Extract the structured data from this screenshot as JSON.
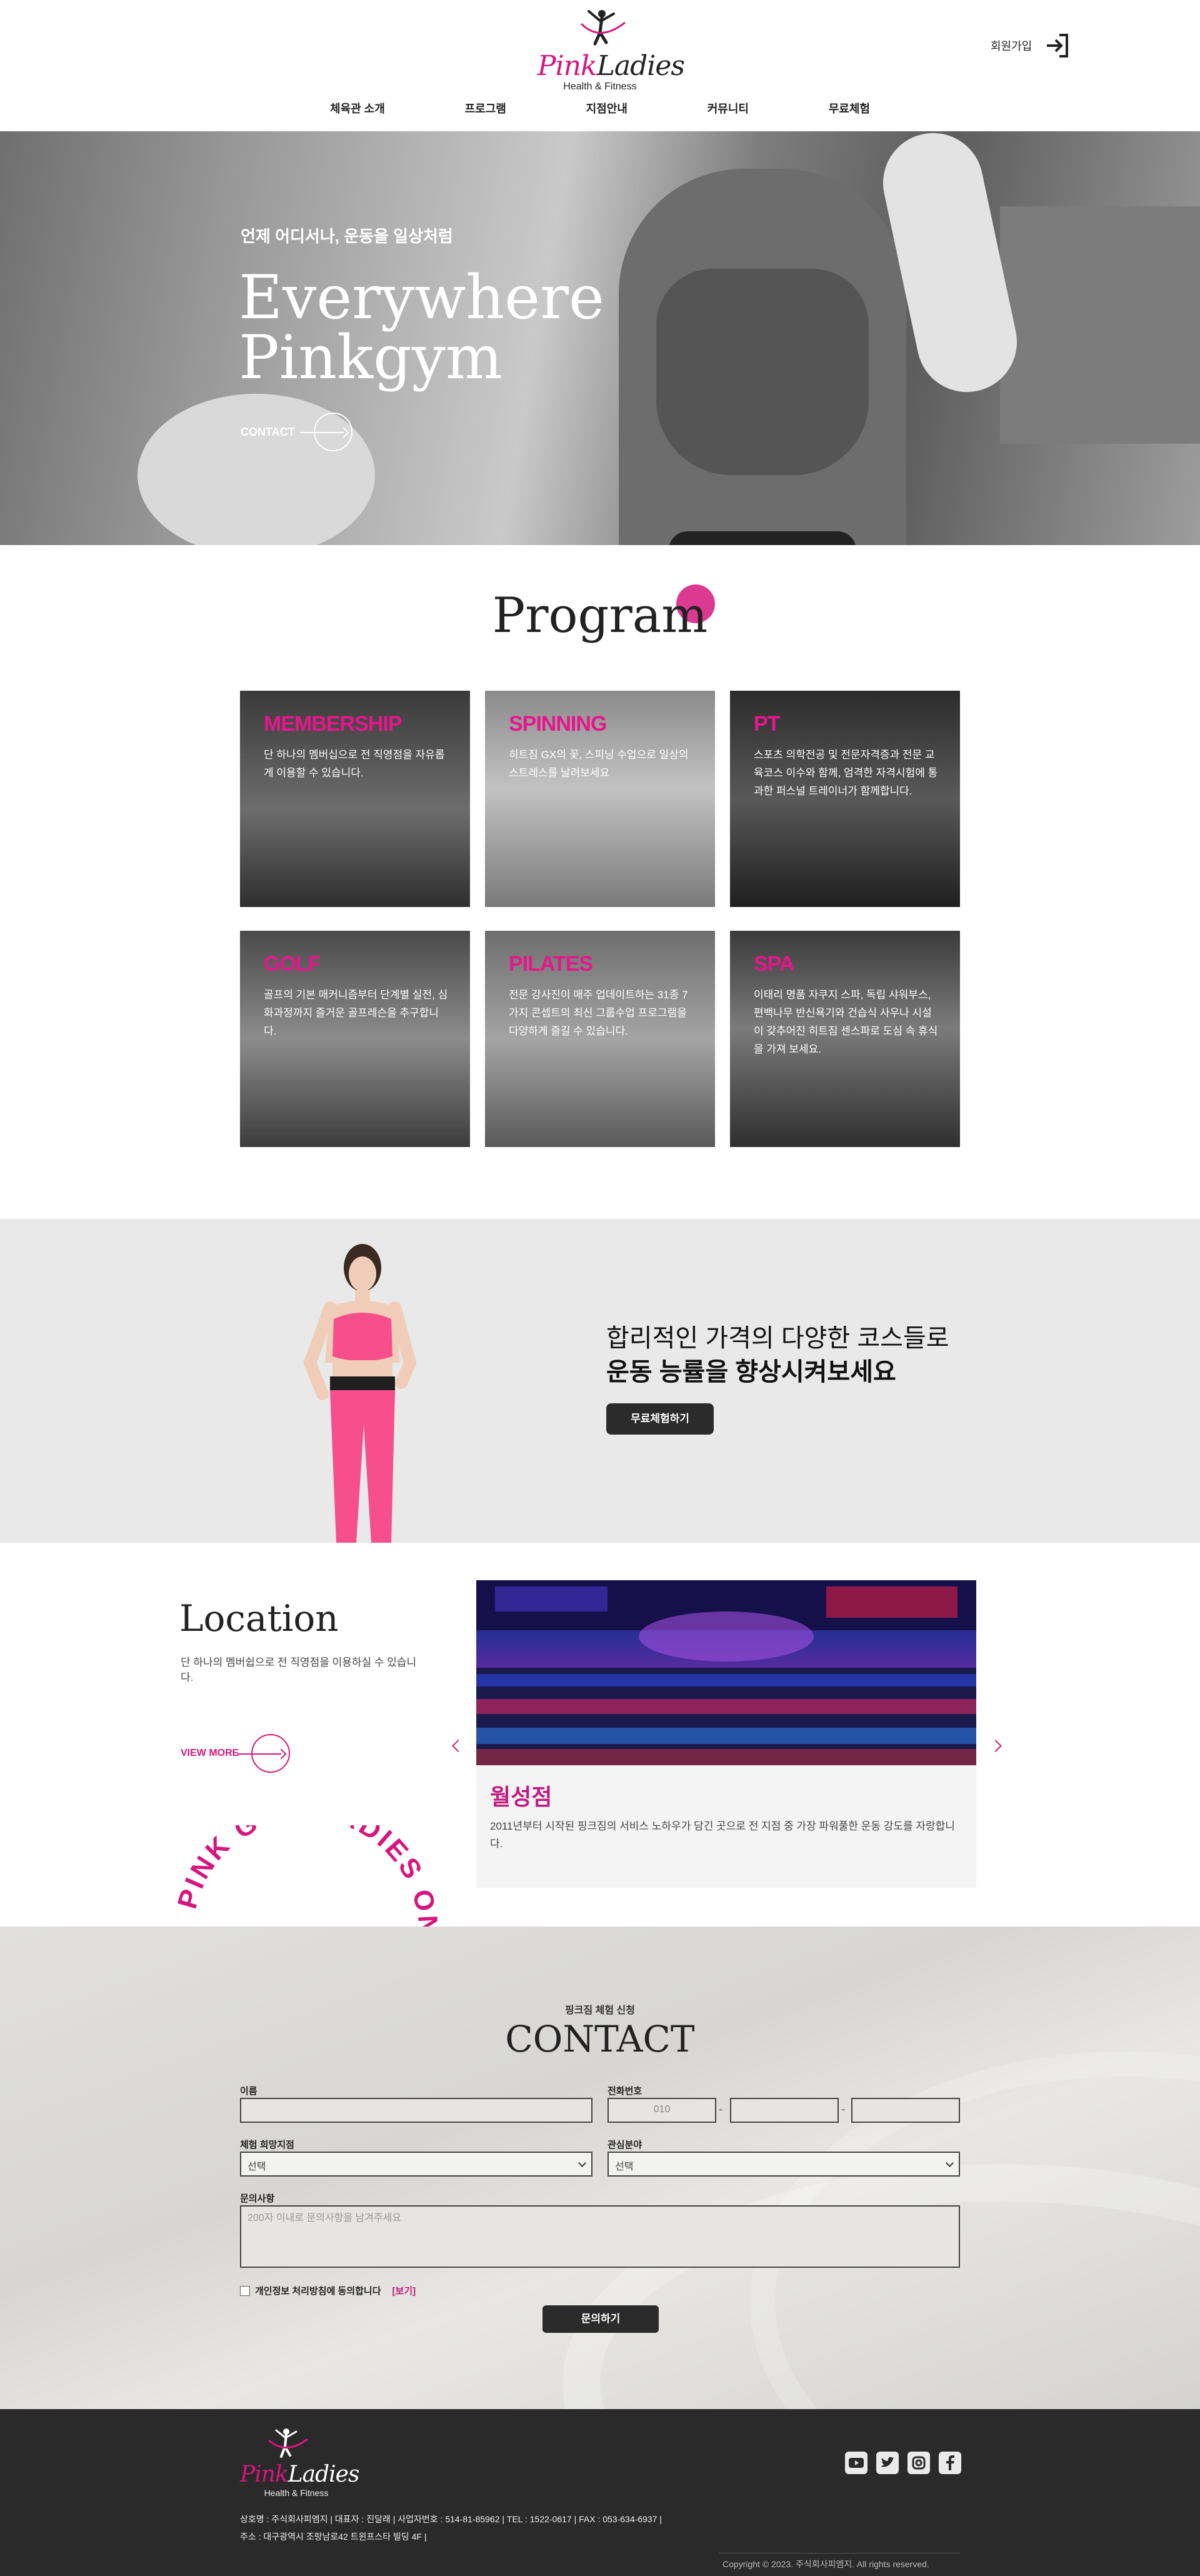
{
  "header": {
    "logo_main": "Pink",
    "logo_accent": "Ladies",
    "logo_sub": "Health & Fitness",
    "join_label": "회원가입",
    "nav": [
      "체육관 소개",
      "프로그램",
      "지점안내",
      "커뮤니티",
      "무료체험"
    ]
  },
  "hero": {
    "subtitle": "언제 어디서나, 운동을 일상처럼",
    "title_line1": "Everywhere",
    "title_line2": "Pinkgym",
    "contact_label": "CONTACT"
  },
  "program": {
    "title": "Program",
    "cards": [
      {
        "name": "MEMBERSHIP",
        "desc": "단 하나의 멤버십으로 전 직영점을 자유롭게 이용할 수 있습니다."
      },
      {
        "name": "SPINNING",
        "desc": "히트짐 GX의 꽃, 스피닝 수업으로 일상의 스트레스를 날려보세요"
      },
      {
        "name": "PT",
        "desc": "스포츠 의학전공 및 전문자격증과 전문 교육코스 이수와 함께, 엄격한 자격시험에 통과한 퍼스널 트레이너가 함께합니다."
      },
      {
        "name": "GOLF",
        "desc": "골프의 기본 매커니즘부터 단계별 실전, 심화과정까지 즐거운 골프레슨을 추구합니다."
      },
      {
        "name": "PILATES",
        "desc": "전문 강사진이 매주 업데이트하는 31종 7가지 콘셉트의 최신 그룹수업 프로그램을 다양하게 즐길 수 있습니다."
      },
      {
        "name": "SPA",
        "desc": "이태리 명품 자쿠지 스파, 독립 샤워부스, 편백나무 반신욕기와 건습식 사우나 시설이 갖추어진 히트짐 센스파로 도심 속 휴식을 가져 보세요."
      }
    ]
  },
  "banner": {
    "line1": "합리적인 가격의 다양한 코스들로",
    "line2": "운동 능률을 향상시켜보세요",
    "button": "무료체험하기"
  },
  "location": {
    "title": "Location",
    "desc": "단 하나의 멤버쉽으로 전 직영점을 이용하실 수 있습니다.",
    "view_more": "VIEW MORE",
    "rotating_text": "PINK GYM LADIES ONLY",
    "branch_name": "월성점",
    "branch_desc": "2011년부터 시작된 핑크짐의 서비스 노하우가 담긴 곳으로 전 지점 중 가장 파워풀한 운동 강도를 자랑합니다."
  },
  "contact": {
    "subtitle": "핑크짐 체험 신청",
    "title": "CONTACT",
    "name_label": "이름",
    "phone_label": "전화번호",
    "phone_placeholder": "010",
    "branch_label": "체험 희망지점",
    "branch_value": "선택",
    "interest_label": "관심분야",
    "interest_value": "선택",
    "inquiry_label": "문의사항",
    "inquiry_placeholder": "200자 이내로 문의사항을 남겨주세요",
    "agree_label": "개인정보 처리방침에 동의합니다",
    "agree_link": "[보기]",
    "submit": "문의하기"
  },
  "footer": {
    "info_line1": "상호명 : 주식회사피엠지  |  대표자 : 진달래  |  사업자번호 : 514-81-85962  |  TEL : 1522-0617  |  FAX : 053-634-6937  |",
    "info_line2": "주소 : 대구광역시 조랑남로42 트윈프스타 빌딩 4F  |",
    "copyright": "Copyright © 2023. 주식회사피엠지. All rights reserved.",
    "socials": [
      "youtube-icon",
      "twitter-icon",
      "instagram-icon",
      "facebook-icon"
    ]
  },
  "colors": {
    "accent": "#d6167e",
    "dark": "#2b2b2b",
    "footer_bg": "#2a2a2a"
  }
}
